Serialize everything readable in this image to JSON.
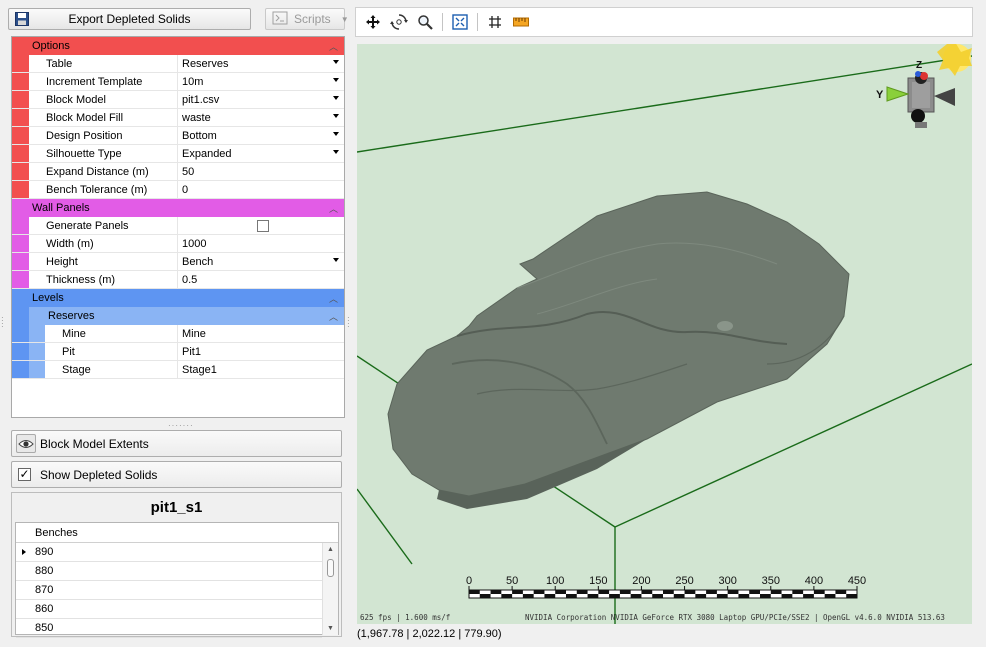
{
  "toolbar_left": {
    "export_label": "Export Depleted Solids",
    "scripts_label": "Scripts"
  },
  "options": {
    "header": "Options",
    "rows": [
      {
        "name": "Table",
        "value": "Reserves",
        "dropdown": true
      },
      {
        "name": "Increment Template",
        "value": "10m",
        "dropdown": true
      },
      {
        "name": "Block Model",
        "value": "pit1.csv",
        "dropdown": true
      },
      {
        "name": "Block Model Fill",
        "value": "waste",
        "dropdown": true
      },
      {
        "name": "Design Position",
        "value": "Bottom",
        "dropdown": true
      },
      {
        "name": "Silhouette Type",
        "value": "Expanded",
        "dropdown": true
      },
      {
        "name": "Expand Distance (m)",
        "value": "50",
        "dropdown": false
      },
      {
        "name": "Bench Tolerance (m)",
        "value": "0",
        "dropdown": false
      }
    ]
  },
  "wall_panels": {
    "header": "Wall Panels",
    "generate_label": "Generate Panels",
    "generate_checked": false,
    "rows": [
      {
        "name": "Width (m)",
        "value": "1000",
        "dropdown": false
      },
      {
        "name": "Height",
        "value": "Bench",
        "dropdown": true
      },
      {
        "name": "Thickness (m)",
        "value": "0.5",
        "dropdown": false
      }
    ]
  },
  "levels": {
    "header": "Levels",
    "reserves_header": "Reserves",
    "rows": [
      {
        "name": "Mine",
        "value": "Mine"
      },
      {
        "name": "Pit",
        "value": "Pit1"
      },
      {
        "name": "Stage",
        "value": "Stage1"
      }
    ]
  },
  "block_model_extents_label": "Block Model Extents",
  "show_depleted": {
    "label": "Show Depleted Solids",
    "checked": true
  },
  "bench_panel": {
    "title": "pit1_s1",
    "column": "Benches",
    "rows": [
      "890",
      "880",
      "870",
      "860",
      "850"
    ],
    "selected_index": 0
  },
  "viewport": {
    "axis_y": "Y",
    "axis_z": "Z",
    "scale_labels": [
      "0",
      "50",
      "100",
      "150",
      "200",
      "250",
      "300",
      "350",
      "400",
      "450"
    ],
    "fps_text": "625 fps | 1.600 ms/f",
    "gpu_text": "NVIDIA Corporation NVIDIA GeForce RTX 3080 Laptop GPU/PCIe/SSE2 | OpenGL v4.6.0 NVIDIA 513.63",
    "coords": "(1,967.78 | 2,022.12 | 779.90)",
    "colors": {
      "background": "#d2e5d2",
      "solid": "#6f7a6f",
      "box_lines": "#1a6b1a"
    }
  },
  "colors": {
    "options": "#f24f4f",
    "wall_panels": "#e25ce6",
    "levels": "#5e95f2",
    "reserves": "#8ab4f4"
  }
}
